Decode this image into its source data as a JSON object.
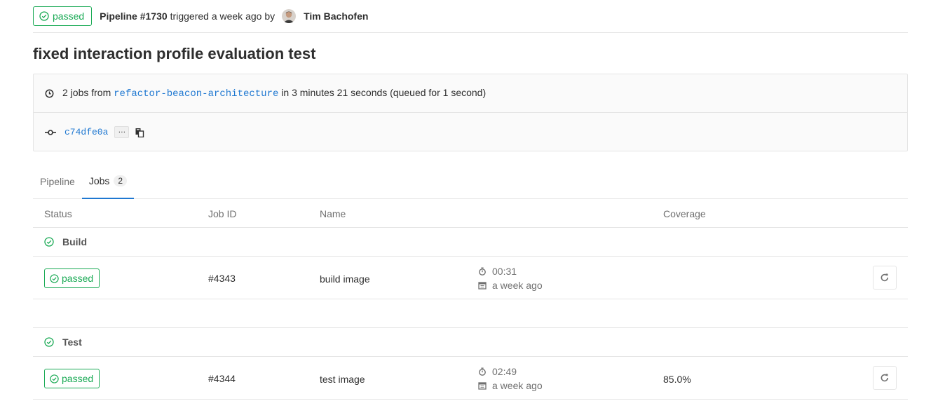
{
  "header": {
    "status": "passed",
    "pipeline_label": "Pipeline #1730",
    "triggered_text": "triggered a week ago by",
    "author": "Tim Bachofen"
  },
  "commit_title": "fixed interaction profile evaluation test",
  "info": {
    "jobs_prefix": "2 jobs from",
    "branch": "refactor-beacon-architecture",
    "duration_text": "in 3 minutes 21 seconds (queued for 1 second)",
    "sha": "c74dfe0a",
    "ellipsis": "…"
  },
  "tabs": [
    {
      "label": "Pipeline"
    },
    {
      "label": "Jobs",
      "count": "2"
    }
  ],
  "columns": {
    "status": "Status",
    "job_id": "Job ID",
    "name": "Name",
    "coverage": "Coverage"
  },
  "stages": [
    {
      "name": "Build",
      "jobs": [
        {
          "status": "passed",
          "id": "#4343",
          "name": "build image",
          "duration": "00:31",
          "finished": "a week ago",
          "coverage": ""
        }
      ]
    },
    {
      "name": "Test",
      "jobs": [
        {
          "status": "passed",
          "id": "#4344",
          "name": "test image",
          "duration": "02:49",
          "finished": "a week ago",
          "coverage": "85.0%"
        }
      ]
    }
  ],
  "colors": {
    "success": "#1aaa55",
    "link": "#1f78d1",
    "border": "#e5e5e5",
    "muted": "#707070"
  },
  "icons": {
    "status": "status-success-icon",
    "clock": "clock-icon",
    "commit": "commit-icon",
    "copy": "clipboard-icon",
    "timer": "timer-icon",
    "calendar": "calendar-icon",
    "retry": "retry-icon"
  }
}
